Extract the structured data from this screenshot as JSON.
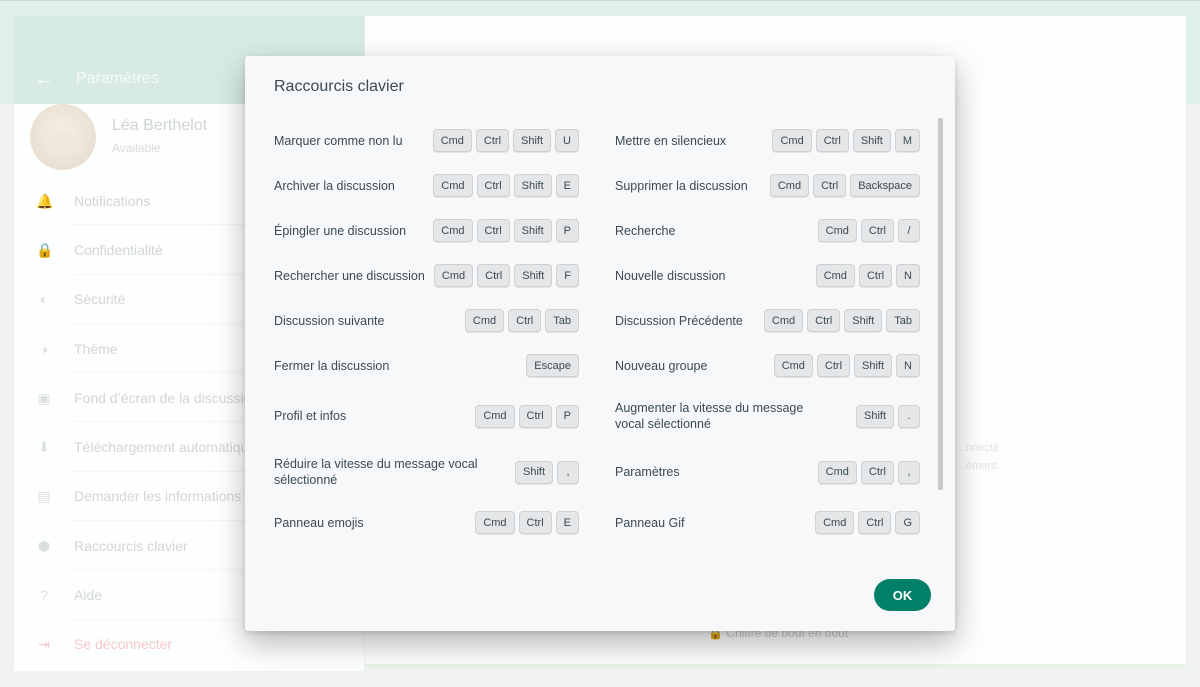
{
  "settings": {
    "title": "Paramètres",
    "back_icon": "arrow-left-icon",
    "profile": {
      "name": "Léa Berthelot",
      "status": "Available"
    },
    "menu": [
      {
        "label": "Notifications",
        "icon": "bell-icon",
        "glyph": "🔔"
      },
      {
        "label": "Confidentialité",
        "icon": "lock-icon",
        "glyph": "🔒"
      },
      {
        "label": "Sécurité",
        "icon": "shield-icon",
        "glyph": "◐"
      },
      {
        "label": "Thème",
        "icon": "theme-icon",
        "glyph": "◑"
      },
      {
        "label": "Fond d’écran de la discussion",
        "icon": "wallpaper-icon",
        "glyph": "▣"
      },
      {
        "label": "Téléchargement automatique",
        "icon": "download-icon",
        "glyph": "⬇"
      },
      {
        "label": "Demander les informations du compte",
        "icon": "document-icon",
        "glyph": "▤"
      },
      {
        "label": "Raccourcis clavier",
        "icon": "keyboard-shortcuts-icon",
        "glyph": "⬢"
      },
      {
        "label": "Aide",
        "icon": "help-icon",
        "glyph": "?"
      },
      {
        "label": "Se déconnecter",
        "icon": "logout-icon",
        "glyph": "⇥"
      }
    ]
  },
  "main": {
    "faint_line_1": "…nnecté.",
    "faint_line_2": "…ément.",
    "bottom_note": "🔒 Chiffré de bout en bout"
  },
  "dialog": {
    "title": "Raccourcis clavier",
    "ok_label": "OK",
    "accent_color": "#008069",
    "left_column": [
      {
        "label": "Marquer comme non lu",
        "keys": [
          "Cmd",
          "Ctrl",
          "Shift",
          "U"
        ]
      },
      {
        "label": "Archiver la discussion",
        "keys": [
          "Cmd",
          "Ctrl",
          "Shift",
          "E"
        ]
      },
      {
        "label": "Épingler une discussion",
        "keys": [
          "Cmd",
          "Ctrl",
          "Shift",
          "P"
        ]
      },
      {
        "label": "Rechercher une discussion",
        "keys": [
          "Cmd",
          "Ctrl",
          "Shift",
          "F"
        ]
      },
      {
        "label": "Discussion suivante",
        "keys": [
          "Cmd",
          "Ctrl",
          "Tab"
        ]
      },
      {
        "label": "Fermer la discussion",
        "keys": [
          "Escape"
        ]
      },
      {
        "label": "Profil et infos",
        "keys": [
          "Cmd",
          "Ctrl",
          "P"
        ]
      },
      {
        "label": "Réduire la vitesse du message vocal sélectionné",
        "keys": [
          "Shift",
          ","
        ]
      },
      {
        "label": "Panneau emojis",
        "keys": [
          "Cmd",
          "Ctrl",
          "E"
        ]
      }
    ],
    "right_column": [
      {
        "label": "Mettre en silencieux",
        "keys": [
          "Cmd",
          "Ctrl",
          "Shift",
          "M"
        ]
      },
      {
        "label": "Supprimer la discussion",
        "keys": [
          "Cmd",
          "Ctrl",
          "Backspace"
        ]
      },
      {
        "label": "Recherche",
        "keys": [
          "Cmd",
          "Ctrl",
          "/"
        ]
      },
      {
        "label": "Nouvelle discussion",
        "keys": [
          "Cmd",
          "Ctrl",
          "N"
        ]
      },
      {
        "label": "Discussion Précédente",
        "keys": [
          "Cmd",
          "Ctrl",
          "Shift",
          "Tab"
        ]
      },
      {
        "label": "Nouveau groupe",
        "keys": [
          "Cmd",
          "Ctrl",
          "Shift",
          "N"
        ]
      },
      {
        "label": "Augmenter la vitesse du message vocal sélectionné",
        "keys": [
          "Shift",
          "."
        ]
      },
      {
        "label": "Paramètres",
        "keys": [
          "Cmd",
          "Ctrl",
          ","
        ]
      },
      {
        "label": "Panneau Gif",
        "keys": [
          "Cmd",
          "Ctrl",
          "G"
        ]
      }
    ]
  }
}
